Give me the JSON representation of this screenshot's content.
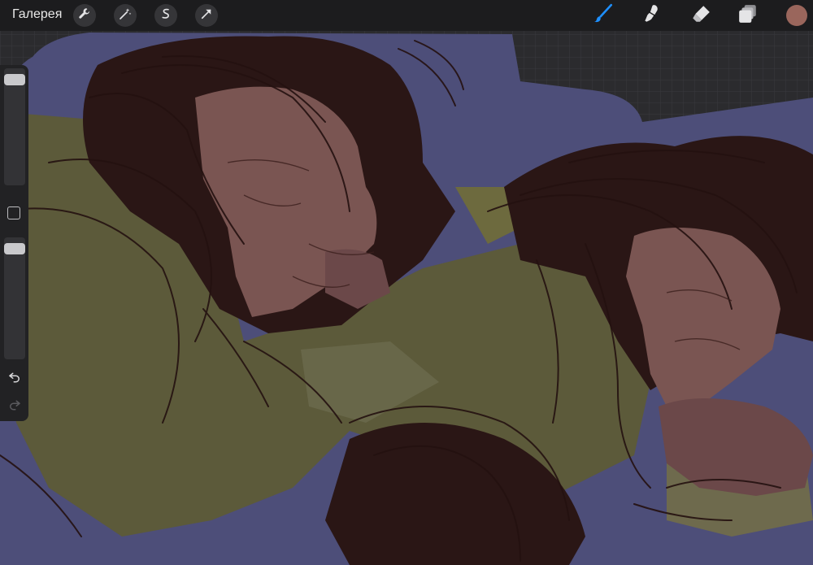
{
  "toolbar": {
    "gallery_label": "Галерея",
    "left_tools": [
      {
        "name": "actions-wrench-icon"
      },
      {
        "name": "adjustments-wand-icon"
      },
      {
        "name": "selection-s-icon"
      },
      {
        "name": "transform-arrow-icon"
      }
    ],
    "right_tools": [
      {
        "name": "brush-icon",
        "active": true,
        "color": "#1e8fff"
      },
      {
        "name": "smudge-icon",
        "active": false
      },
      {
        "name": "eraser-icon",
        "active": false
      },
      {
        "name": "layers-icon",
        "active": false
      }
    ],
    "current_color": "#9a665c"
  },
  "sidebar": {
    "brush_size": 0.95,
    "brush_opacity": 0.95,
    "modify_button": "modify-square",
    "undo": "undo-icon",
    "redo": "redo-icon"
  },
  "colors": {
    "background_grid": "#2b2b2e",
    "blanket_blue": "#4d4e79",
    "clothing_olive": "#5c5a3a",
    "hair_dark": "#2a1615",
    "skin": "#7a5552"
  }
}
